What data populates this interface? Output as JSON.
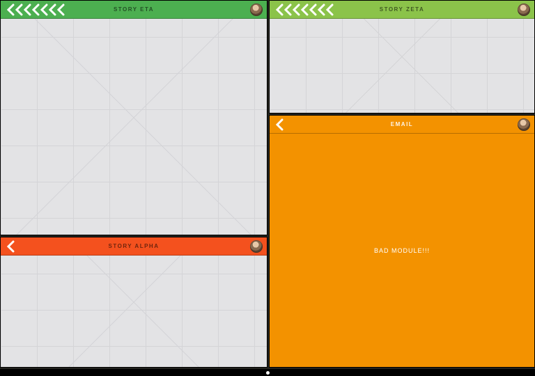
{
  "panels": {
    "eta": {
      "title": "STORY ETA",
      "header_color": "#4CAF50",
      "chevron_count": 7,
      "chevron_color": "#ffffff"
    },
    "zeta": {
      "title": "STORY ZETA",
      "header_color": "#8BC34A",
      "chevron_count": 7,
      "chevron_color": "#ffffff"
    },
    "alpha": {
      "title": "STORY ALPHA",
      "header_color": "#F4511E",
      "chevron_count": 1,
      "chevron_color": "#ffffff"
    },
    "email": {
      "title": "EMAIL",
      "header_color": "#F39200",
      "chevron_count": 1,
      "chevron_color": "#ffffff",
      "body_text": "BAD MODULE!!!"
    }
  }
}
